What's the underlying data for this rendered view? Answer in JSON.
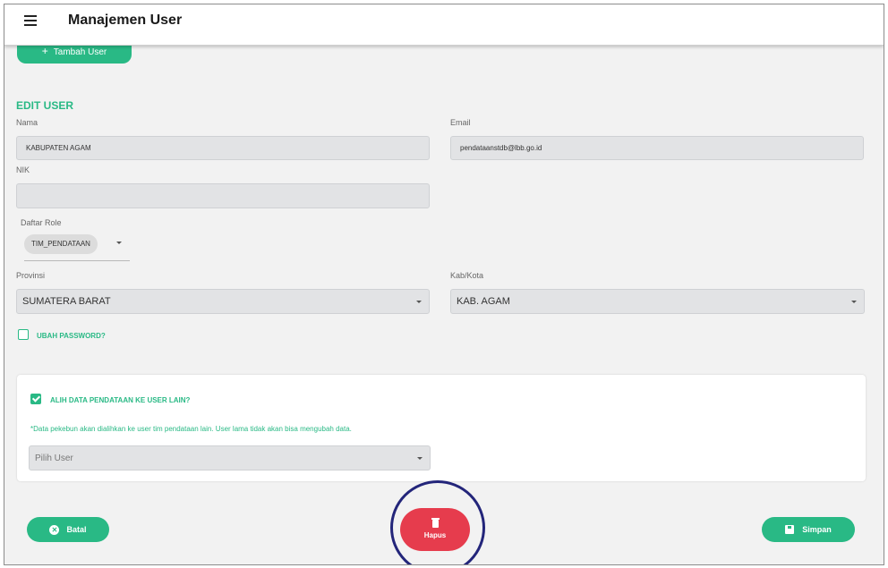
{
  "header": {
    "title": "Manajemen User"
  },
  "actions": {
    "add_user_label": "Tambah User"
  },
  "form": {
    "section_title": "EDIT USER",
    "nama": {
      "label": "Nama",
      "value": "KABUPATEN AGAM"
    },
    "email": {
      "label": "Email",
      "value": "pendataanstdb@lbb.go.id"
    },
    "nik": {
      "label": "NIK",
      "value": ""
    },
    "role": {
      "label": "Daftar Role",
      "chip": "TIM_PENDATAAN"
    },
    "provinsi": {
      "label": "Provinsi",
      "value": "SUMATERA BARAT"
    },
    "kabkota": {
      "label": "Kab/Kota",
      "value": "KAB. AGAM"
    },
    "ubah_password": {
      "label": "UBAH PASSWORD?",
      "checked": false
    }
  },
  "transfer": {
    "checkbox_label": "ALIH DATA PENDATAAN KE USER LAIN?",
    "checked": true,
    "note": "*Data pekebun akan dialihkan ke user tim pendataan lain. User lama tidak akan bisa mengubah data.",
    "select_placeholder": "Pilih User"
  },
  "footer": {
    "cancel_label": "Batal",
    "delete_label": "Hapus",
    "save_label": "Simpan"
  },
  "colors": {
    "accent": "#29b985",
    "danger": "#e63c4d",
    "highlight_ring": "#23257a"
  },
  "icons": [
    "menu-icon",
    "plus-icon",
    "chevron-down-icon",
    "checkbox-icon",
    "close-circle-icon",
    "trash-icon",
    "save-icon"
  ]
}
